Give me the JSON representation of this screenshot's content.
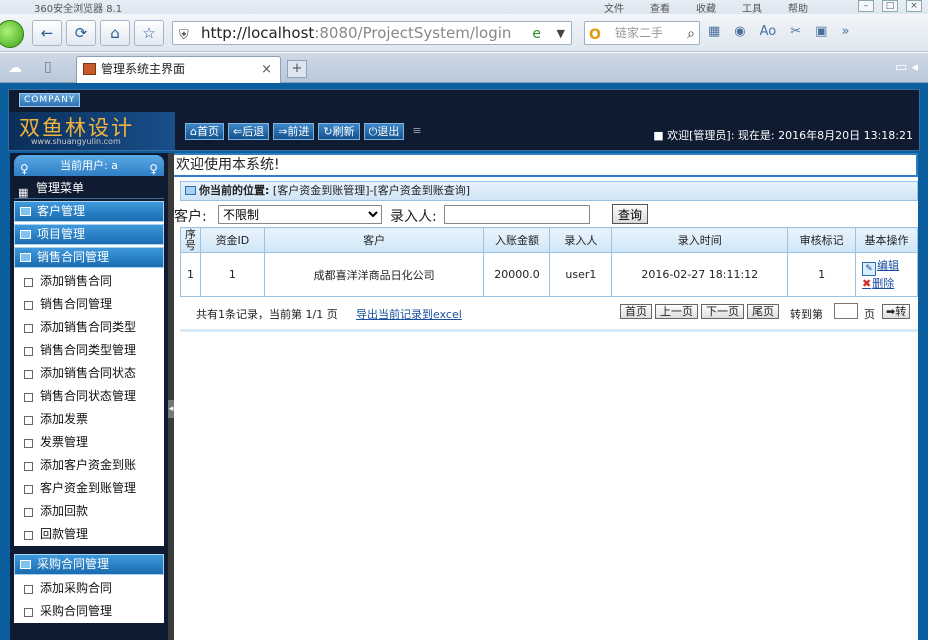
{
  "browser": {
    "window_title": "360安全浏览器 8.1",
    "menus": [
      "文件",
      "查看",
      "收藏",
      "工具",
      "帮助"
    ],
    "address": {
      "host": "http://localhost",
      "path": ":8080/ProjectSystem/login"
    },
    "search_placeholder": "链家二手",
    "tab_title": "管理系统主界面"
  },
  "header": {
    "company_label": "COMPANY",
    "brand_name": "双鱼林设计",
    "brand_url": "www.shuangyulin.com",
    "nav": [
      "首页",
      "后退",
      "前进",
      "刷新",
      "退出"
    ],
    "welcome": "欢迎[管理员]: 现在是: 2016年8月20日 13:18:21"
  },
  "sidebar": {
    "current_user": "当前用户: a",
    "menu_title": "管理菜单",
    "groups": [
      {
        "label": "客户管理",
        "items": []
      },
      {
        "label": "项目管理",
        "items": []
      },
      {
        "label": "销售合同管理",
        "items": [
          "添加销售合同",
          "销售合同管理",
          "添加销售合同类型",
          "销售合同类型管理",
          "添加销售合同状态",
          "销售合同状态管理",
          "添加发票",
          "发票管理",
          "添加客户资金到账",
          "客户资金到账管理",
          "添加回款",
          "回款管理"
        ]
      },
      {
        "label": "采购合同管理",
        "items": [
          "添加采购合同",
          "采购合同管理"
        ]
      }
    ]
  },
  "main": {
    "welcome_text": "欢迎使用本系统!",
    "location_label": "你当前的位置:",
    "location_path": "[客户资金到账管理]-[客户资金到账查询]",
    "filter": {
      "customer_label": "客户:",
      "customer_value": "不限制",
      "entry_label": "录入人:",
      "entry_value": "",
      "query_button": "查询"
    },
    "table": {
      "headers": [
        "序号",
        "资金ID",
        "客户",
        "入账金额",
        "录入人",
        "录入时间",
        "审核标记",
        "基本操作"
      ],
      "rows": [
        {
          "seq": "1",
          "fund_id": "1",
          "customer": "成都喜洋洋商品日化公司",
          "amount": "20000.0",
          "entered_by": "user1",
          "entry_time": "2016-02-27 18:11:12",
          "audit": "1",
          "edit": "编辑",
          "delete": "删除"
        }
      ]
    },
    "pager": {
      "summary": "共有1条记录，当前第 1/1 页",
      "export": "导出当前记录到excel",
      "buttons": [
        "首页",
        "上一页",
        "下一页",
        "尾页"
      ],
      "goto_label": "转到第",
      "page_label": "页",
      "go_button": "转"
    }
  }
}
